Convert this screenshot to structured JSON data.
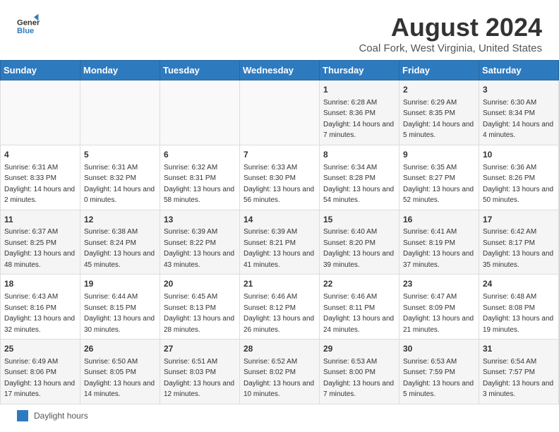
{
  "header": {
    "logo_general": "General",
    "logo_blue": "Blue",
    "month_year": "August 2024",
    "location": "Coal Fork, West Virginia, United States"
  },
  "columns": [
    "Sunday",
    "Monday",
    "Tuesday",
    "Wednesday",
    "Thursday",
    "Friday",
    "Saturday"
  ],
  "weeks": [
    [
      {
        "day": "",
        "info": ""
      },
      {
        "day": "",
        "info": ""
      },
      {
        "day": "",
        "info": ""
      },
      {
        "day": "",
        "info": ""
      },
      {
        "day": "1",
        "info": "Sunrise: 6:28 AM\nSunset: 8:36 PM\nDaylight: 14 hours and 7 minutes."
      },
      {
        "day": "2",
        "info": "Sunrise: 6:29 AM\nSunset: 8:35 PM\nDaylight: 14 hours and 5 minutes."
      },
      {
        "day": "3",
        "info": "Sunrise: 6:30 AM\nSunset: 8:34 PM\nDaylight: 14 hours and 4 minutes."
      }
    ],
    [
      {
        "day": "4",
        "info": "Sunrise: 6:31 AM\nSunset: 8:33 PM\nDaylight: 14 hours and 2 minutes."
      },
      {
        "day": "5",
        "info": "Sunrise: 6:31 AM\nSunset: 8:32 PM\nDaylight: 14 hours and 0 minutes."
      },
      {
        "day": "6",
        "info": "Sunrise: 6:32 AM\nSunset: 8:31 PM\nDaylight: 13 hours and 58 minutes."
      },
      {
        "day": "7",
        "info": "Sunrise: 6:33 AM\nSunset: 8:30 PM\nDaylight: 13 hours and 56 minutes."
      },
      {
        "day": "8",
        "info": "Sunrise: 6:34 AM\nSunset: 8:28 PM\nDaylight: 13 hours and 54 minutes."
      },
      {
        "day": "9",
        "info": "Sunrise: 6:35 AM\nSunset: 8:27 PM\nDaylight: 13 hours and 52 minutes."
      },
      {
        "day": "10",
        "info": "Sunrise: 6:36 AM\nSunset: 8:26 PM\nDaylight: 13 hours and 50 minutes."
      }
    ],
    [
      {
        "day": "11",
        "info": "Sunrise: 6:37 AM\nSunset: 8:25 PM\nDaylight: 13 hours and 48 minutes."
      },
      {
        "day": "12",
        "info": "Sunrise: 6:38 AM\nSunset: 8:24 PM\nDaylight: 13 hours and 45 minutes."
      },
      {
        "day": "13",
        "info": "Sunrise: 6:39 AM\nSunset: 8:22 PM\nDaylight: 13 hours and 43 minutes."
      },
      {
        "day": "14",
        "info": "Sunrise: 6:39 AM\nSunset: 8:21 PM\nDaylight: 13 hours and 41 minutes."
      },
      {
        "day": "15",
        "info": "Sunrise: 6:40 AM\nSunset: 8:20 PM\nDaylight: 13 hours and 39 minutes."
      },
      {
        "day": "16",
        "info": "Sunrise: 6:41 AM\nSunset: 8:19 PM\nDaylight: 13 hours and 37 minutes."
      },
      {
        "day": "17",
        "info": "Sunrise: 6:42 AM\nSunset: 8:17 PM\nDaylight: 13 hours and 35 minutes."
      }
    ],
    [
      {
        "day": "18",
        "info": "Sunrise: 6:43 AM\nSunset: 8:16 PM\nDaylight: 13 hours and 32 minutes."
      },
      {
        "day": "19",
        "info": "Sunrise: 6:44 AM\nSunset: 8:15 PM\nDaylight: 13 hours and 30 minutes."
      },
      {
        "day": "20",
        "info": "Sunrise: 6:45 AM\nSunset: 8:13 PM\nDaylight: 13 hours and 28 minutes."
      },
      {
        "day": "21",
        "info": "Sunrise: 6:46 AM\nSunset: 8:12 PM\nDaylight: 13 hours and 26 minutes."
      },
      {
        "day": "22",
        "info": "Sunrise: 6:46 AM\nSunset: 8:11 PM\nDaylight: 13 hours and 24 minutes."
      },
      {
        "day": "23",
        "info": "Sunrise: 6:47 AM\nSunset: 8:09 PM\nDaylight: 13 hours and 21 minutes."
      },
      {
        "day": "24",
        "info": "Sunrise: 6:48 AM\nSunset: 8:08 PM\nDaylight: 13 hours and 19 minutes."
      }
    ],
    [
      {
        "day": "25",
        "info": "Sunrise: 6:49 AM\nSunset: 8:06 PM\nDaylight: 13 hours and 17 minutes."
      },
      {
        "day": "26",
        "info": "Sunrise: 6:50 AM\nSunset: 8:05 PM\nDaylight: 13 hours and 14 minutes."
      },
      {
        "day": "27",
        "info": "Sunrise: 6:51 AM\nSunset: 8:03 PM\nDaylight: 13 hours and 12 minutes."
      },
      {
        "day": "28",
        "info": "Sunrise: 6:52 AM\nSunset: 8:02 PM\nDaylight: 13 hours and 10 minutes."
      },
      {
        "day": "29",
        "info": "Sunrise: 6:53 AM\nSunset: 8:00 PM\nDaylight: 13 hours and 7 minutes."
      },
      {
        "day": "30",
        "info": "Sunrise: 6:53 AM\nSunset: 7:59 PM\nDaylight: 13 hours and 5 minutes."
      },
      {
        "day": "31",
        "info": "Sunrise: 6:54 AM\nSunset: 7:57 PM\nDaylight: 13 hours and 3 minutes."
      }
    ]
  ],
  "legend": {
    "label": "Daylight hours"
  }
}
